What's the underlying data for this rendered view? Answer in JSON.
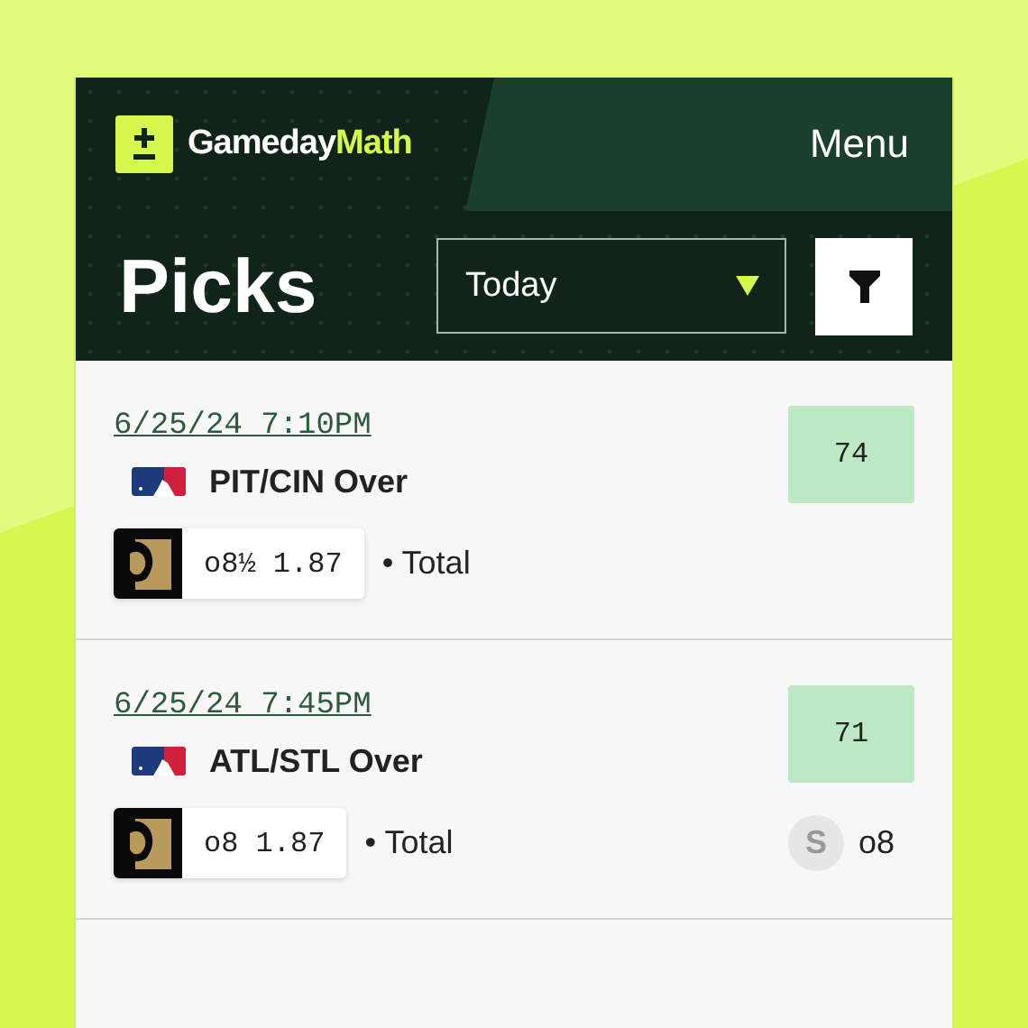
{
  "header": {
    "logo": {
      "first": "Gameday",
      "second": "Math"
    },
    "menu": "Menu"
  },
  "title": "Picks",
  "date_filter": {
    "value": "Today"
  },
  "picks": [
    {
      "datetime": "6/25/24 7:10PM",
      "matchup": "PIT/CIN Over",
      "score": "74",
      "line": "o8½ 1.87",
      "market": "• Total"
    },
    {
      "datetime": "6/25/24 7:45PM",
      "matchup": "ATL/STL Over",
      "score": "71",
      "line": "o8 1.87",
      "market": "• Total",
      "consensus": {
        "badge": "S",
        "line": "o8"
      }
    }
  ]
}
